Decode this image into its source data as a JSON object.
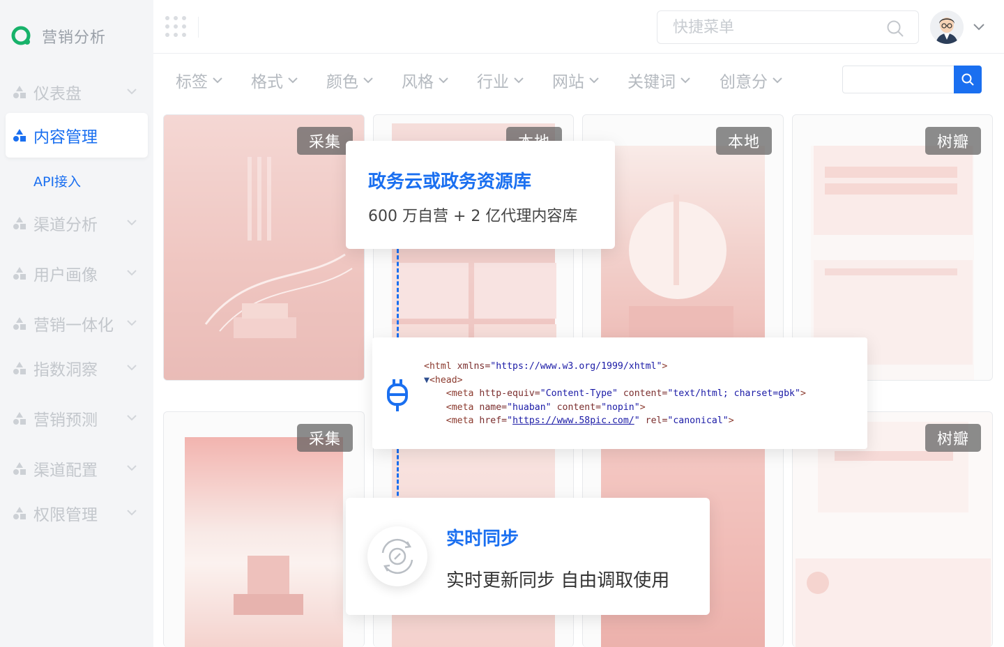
{
  "app": {
    "title": "营销分析"
  },
  "sidebar": {
    "items": [
      {
        "label": "仪表盘",
        "active": false
      },
      {
        "label": "内容管理",
        "active": true,
        "sub": "API接入"
      },
      {
        "label": "渠道分析",
        "active": false
      },
      {
        "label": "用户画像",
        "active": false
      },
      {
        "label": "营销一体化",
        "active": false
      },
      {
        "label": "指数洞察",
        "active": false
      },
      {
        "label": "营销预测",
        "active": false
      },
      {
        "label": "渠道配置",
        "active": false
      },
      {
        "label": "权限管理",
        "active": false
      }
    ]
  },
  "header": {
    "search_placeholder": "快捷菜单"
  },
  "filters": [
    "标签",
    "格式",
    "颜色",
    "风格",
    "行业",
    "网站",
    "关键词",
    "创意分"
  ],
  "gallery": {
    "badges": [
      "采集",
      "本地",
      "本地",
      "树瓣",
      "采集",
      "树瓣"
    ]
  },
  "panel_repo": {
    "title": "政务云或政务资源库",
    "subtitle": "600 万自营 + 2 亿代理内容库"
  },
  "code": {
    "line1_tag": "<html",
    "line1_attr": " xmlns=",
    "line1_val": "\"https://www.w3.org/1999/xhtml\"",
    "line1_end": ">",
    "line2": "<head>",
    "line3_tag": "<meta",
    "line3_attr1": " http-equiv=",
    "line3_val1": "\"Content-Type\"",
    "line3_attr2": " content=",
    "line3_val2": "\"text/html; charset=gbk\"",
    "line3_end": ">",
    "line4_tag": "<meta",
    "line4_attr1": " name=",
    "line4_val1": "\"huaban\"",
    "line4_attr2": " content=",
    "line4_val2": "\"nopin\"",
    "line4_end": ">",
    "line5_tag": "<meta",
    "line5_attr1": " href=",
    "line5_q1": "\"",
    "line5_link": "https://www.58pic.com/",
    "line5_q2": "\"",
    "line5_attr2": " rel=",
    "line5_val2": "\"canonical\"",
    "line5_end": ">"
  },
  "panel_sync": {
    "title": "实时同步",
    "subtitle": "实时更新同步 自由调取使用"
  },
  "colors": {
    "accent": "#1a6ff0",
    "poster_red": "#d0392f"
  }
}
